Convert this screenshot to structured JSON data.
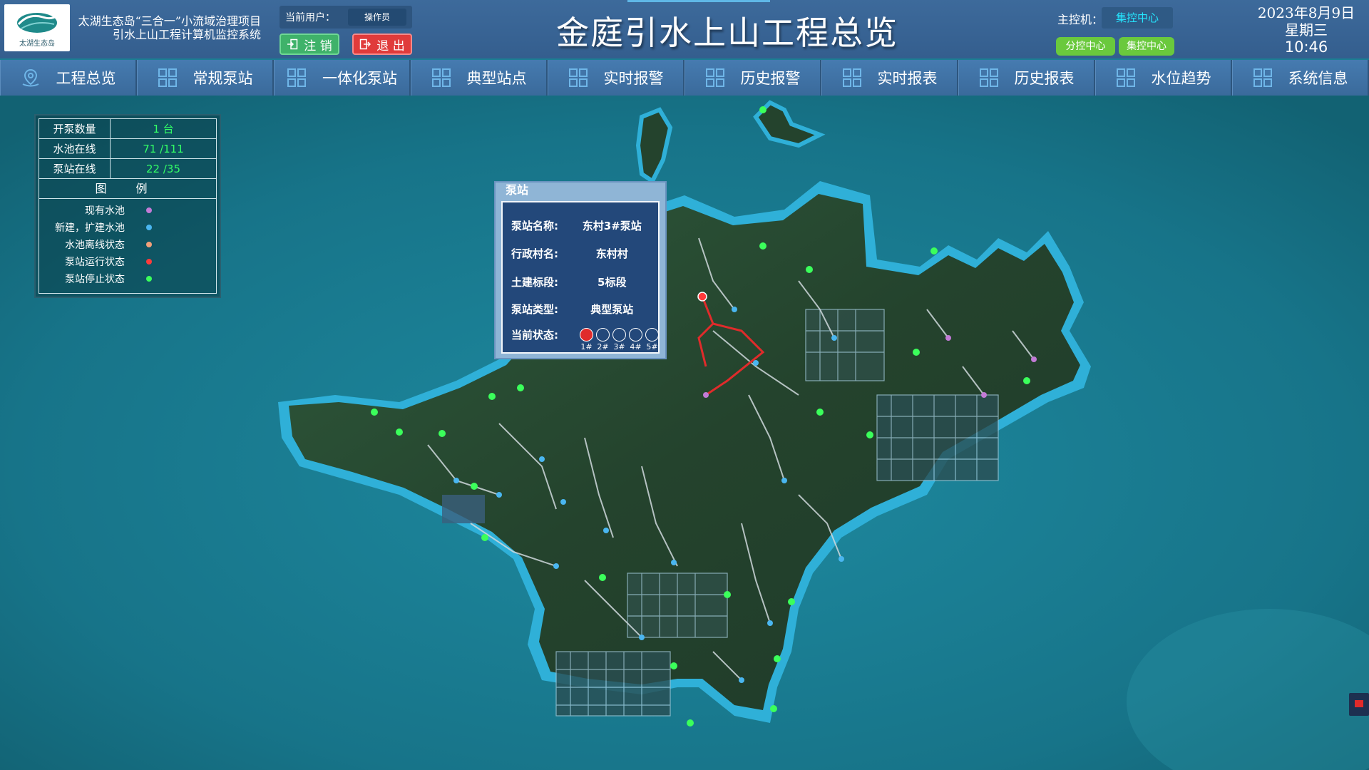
{
  "header": {
    "logo_text": "太湖生态岛",
    "project_title_line1": "太湖生态岛“三合一”小流域治理项目",
    "project_title_line2": "引水上山工程计算机监控系统",
    "current_user_label": "当前用户：",
    "current_user_value": "操作员",
    "logout_label": "注 销",
    "exit_label": "退 出",
    "main_title": "金庭引水上山工程总览",
    "host_label": "主控机：",
    "host_value": "集控中心",
    "sub_center_label": "分控中心",
    "main_center_label": "集控中心",
    "date": "2023年8月9日",
    "weekday": "星期三",
    "time": "10:46"
  },
  "nav": {
    "items": [
      {
        "label": "工程总览",
        "icon": "map-pin-icon"
      },
      {
        "label": "常规泵站",
        "icon": "grid-icon"
      },
      {
        "label": "一体化泵站",
        "icon": "grid-icon"
      },
      {
        "label": "典型站点",
        "icon": "grid-icon"
      },
      {
        "label": "实时报警",
        "icon": "grid-icon"
      },
      {
        "label": "历史报警",
        "icon": "grid-icon"
      },
      {
        "label": "实时报表",
        "icon": "grid-icon"
      },
      {
        "label": "历史报表",
        "icon": "grid-icon"
      },
      {
        "label": "水位趋势",
        "icon": "grid-icon"
      },
      {
        "label": "系统信息",
        "icon": "grid-icon"
      }
    ]
  },
  "stats": {
    "rows": [
      {
        "key": "开泵数量",
        "value": "1 台"
      },
      {
        "key": "水池在线",
        "value": "71 /111"
      },
      {
        "key": "泵站在线",
        "value": "22 /35"
      }
    ],
    "legend_title": "图 例",
    "legend": [
      {
        "label": "现有水池",
        "color": "#c27bd6"
      },
      {
        "label": "新建，扩建水池",
        "color": "#4ab6f0"
      },
      {
        "label": "水池离线状态",
        "color": "#f2a07a"
      },
      {
        "label": "泵站运行状态",
        "color": "#ff3b3b"
      },
      {
        "label": "泵站停止状态",
        "color": "#3bff5b"
      }
    ]
  },
  "popup": {
    "title": "泵站",
    "rows": [
      {
        "key": "泵站名称:",
        "value": "东村3#泵站"
      },
      {
        "key": "行政村名:",
        "value": "东村村"
      },
      {
        "key": "土建标段:",
        "value": "5标段"
      },
      {
        "key": "泵站类型:",
        "value": "典型泵站"
      }
    ],
    "status_label": "当前状态:",
    "pumps": [
      {
        "label": "1#",
        "state": "run"
      },
      {
        "label": "2#",
        "state": "stop"
      },
      {
        "label": "3#",
        "state": "stop"
      },
      {
        "label": "4#",
        "state": "stop"
      },
      {
        "label": "5#",
        "state": "stop"
      }
    ]
  },
  "colors": {
    "header_bg": "#3d6a9b",
    "nav_bg": "#467bb0",
    "sea": "#1c7e94",
    "land": "#2a4a33",
    "running_red": "#e02b2b",
    "online_green": "#33ff66"
  }
}
